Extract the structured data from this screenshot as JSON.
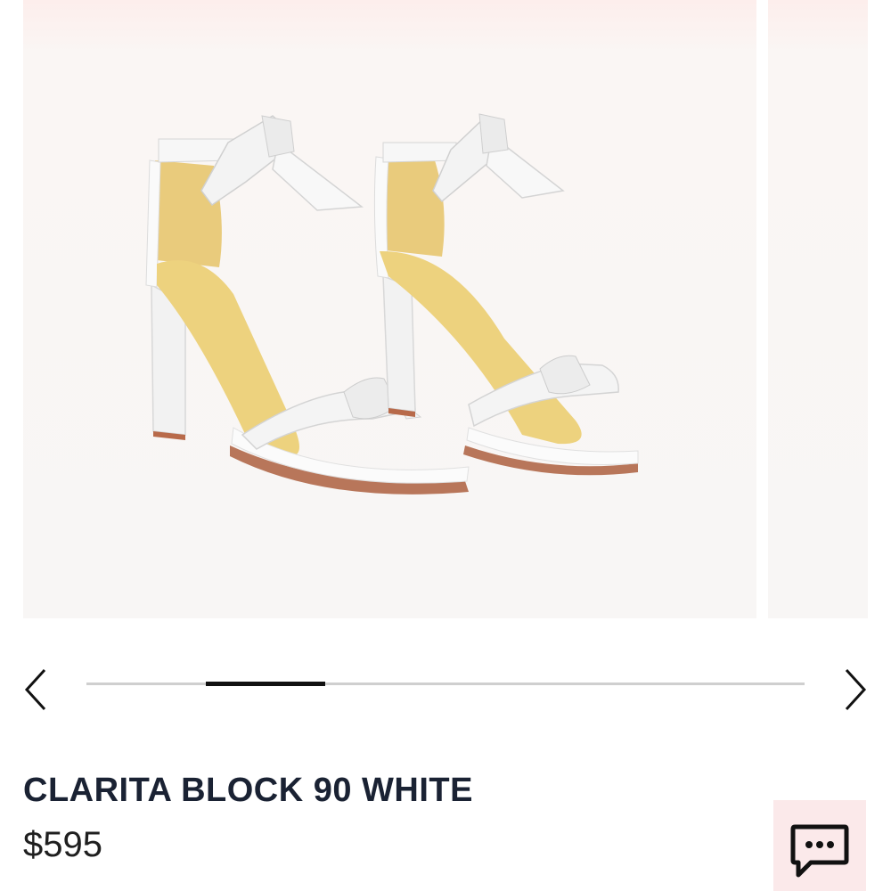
{
  "gallery": {
    "image": {
      "alt": "",
      "icon": "white-ankle-tie-block-heel-sandals"
    },
    "progress": {
      "current_fraction_start": 0.166,
      "current_fraction_end": 0.333
    }
  },
  "carousel": {
    "prev_icon": "chevron-left-icon",
    "next_icon": "chevron-right-icon"
  },
  "product": {
    "name": "CLARITA BLOCK 90 WHITE",
    "price": "$595"
  },
  "chat": {
    "icon": "chat-bubble-icon",
    "background": "#fbe9ea"
  }
}
